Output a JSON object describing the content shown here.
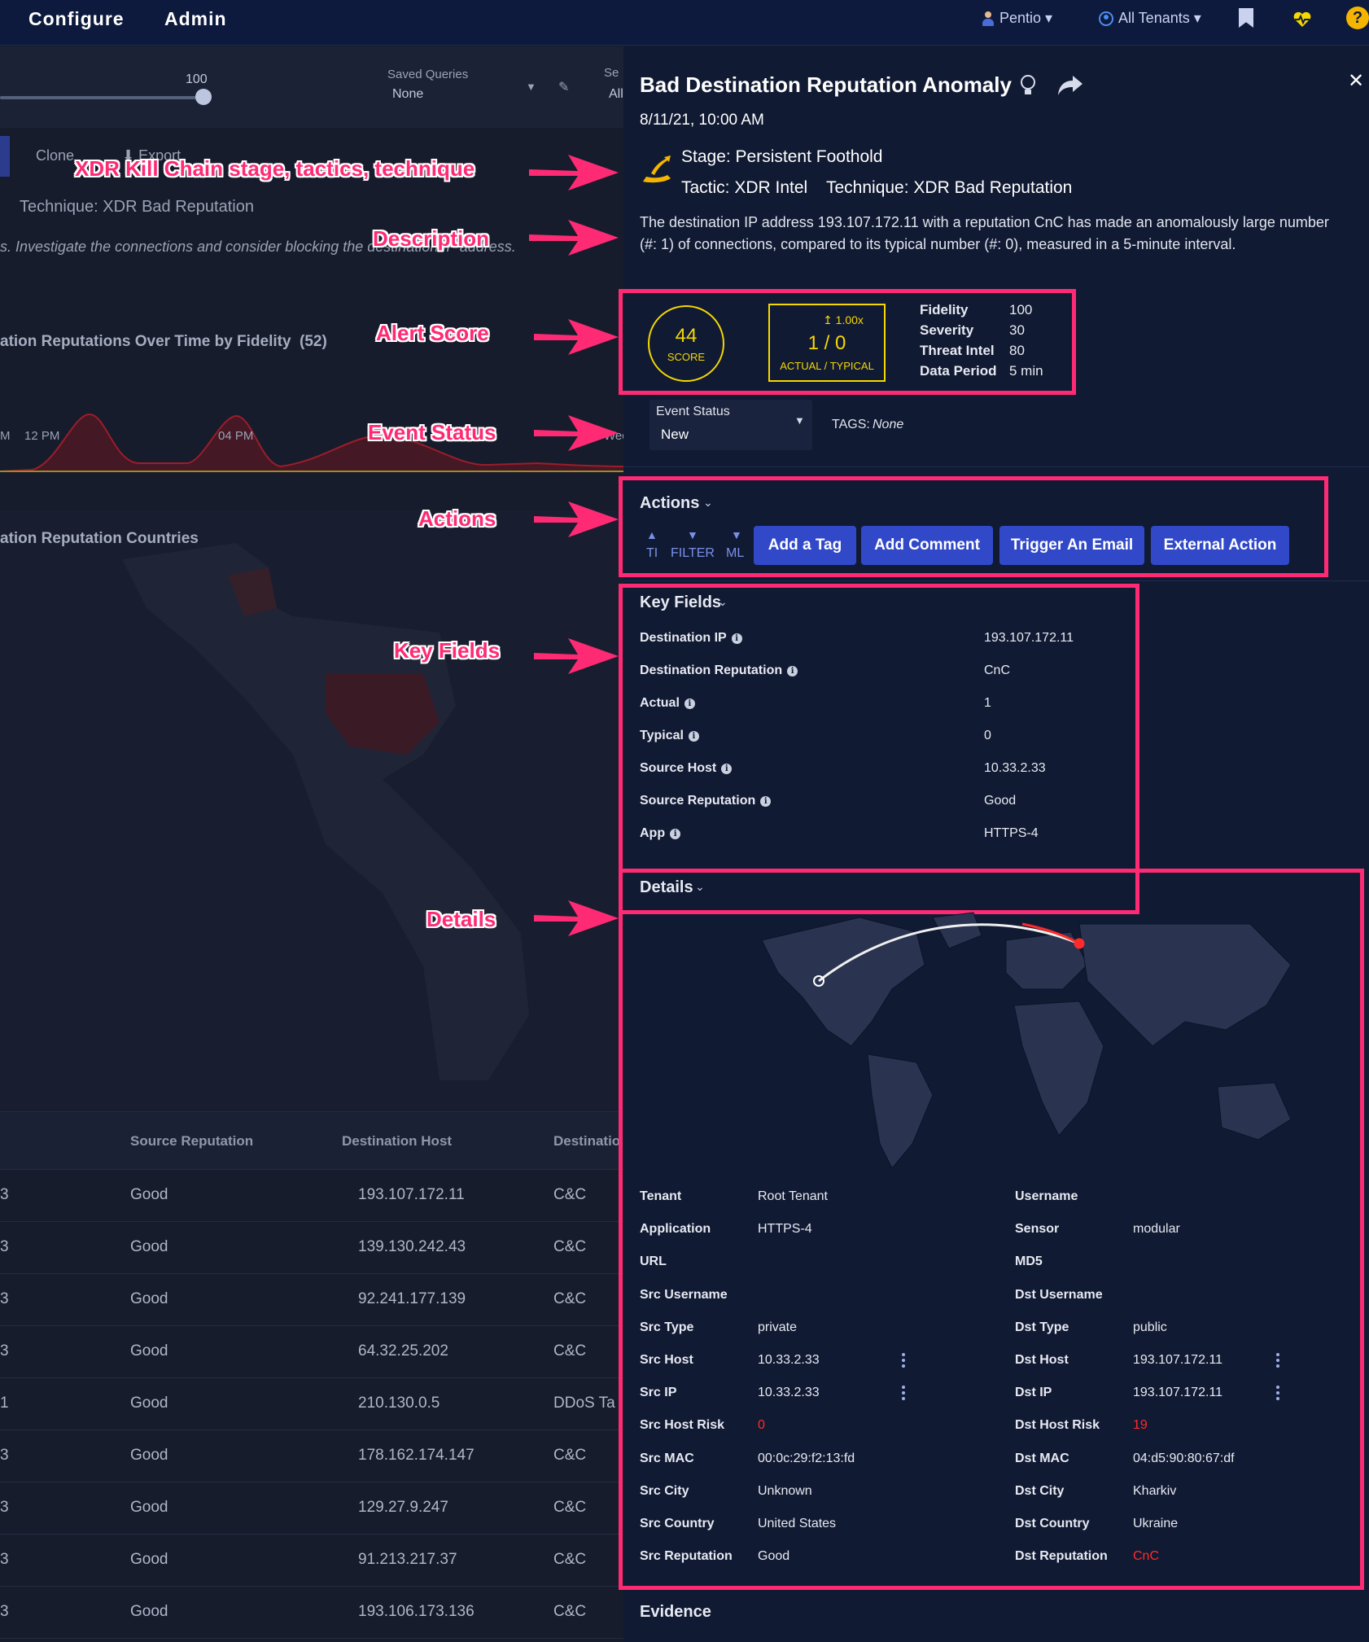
{
  "nav": {
    "configure": "Configure",
    "admin": "Admin",
    "user": "Pentio ▾",
    "tenants": "All Tenants ▾",
    "help": "?"
  },
  "left": {
    "slider_value": "100",
    "saved_queries_label": "Saved Queries",
    "saved_queries_value": "None",
    "sel_label": "Se",
    "sel_value": "All",
    "clone": "Clone",
    "export": "⬇ Export",
    "technique": "Technique: XDR Bad Reputation",
    "description": "s. Investigate the connections and consider blocking the destination IP address.",
    "chart_title": "ation Reputations Over Time by Fidelity",
    "chart_count": "(52)",
    "tick_am": "M",
    "tick_12pm": "12 PM",
    "tick_04pm": "04 PM",
    "tick_wed": "Wed",
    "countries_title": "ation Reputation Countries",
    "table": {
      "headers": [
        "Source Reputation",
        "Destination Host",
        "Destinatio"
      ],
      "rows": [
        [
          "3",
          "Good",
          "193.107.172.11",
          "C&C"
        ],
        [
          "3",
          "Good",
          "139.130.242.43",
          "C&C"
        ],
        [
          "3",
          "Good",
          "92.241.177.139",
          "C&C"
        ],
        [
          "3",
          "Good",
          "64.32.25.202",
          "C&C"
        ],
        [
          "1",
          "Good",
          "210.130.0.5",
          "DDoS Ta"
        ],
        [
          "3",
          "Good",
          "178.162.174.147",
          "C&C"
        ],
        [
          "3",
          "Good",
          "129.27.9.247",
          "C&C"
        ],
        [
          "3",
          "Good",
          "91.213.217.37",
          "C&C"
        ],
        [
          "3",
          "Good",
          "193.106.173.136",
          "C&C"
        ]
      ]
    }
  },
  "annotations": {
    "kill_chain": "XDR Kill Chain stage, tactics, technique",
    "description": "Description",
    "alert_score": "Alert Score",
    "event_status": "Event Status",
    "actions": "Actions",
    "key_fields": "Key Fields",
    "details": "Details"
  },
  "alert": {
    "title": "Bad Destination Reputation Anomaly",
    "datetime": "8/11/21, 10:00 AM",
    "stage": "Stage: Persistent Foothold",
    "tactic": "Tactic: XDR Intel",
    "technique": "Technique: XDR Bad Reputation",
    "description_line1": "The destination IP address 193.107.172.11 with a reputation CnC has made an anomalously large number",
    "description_line2": "(#: 1) of connections, compared to its typical number (#: 0), measured in a 5-minute interval.",
    "score": "44",
    "score_label": "SCORE",
    "ratio_multiplier": "↥ 1.00x",
    "ratio": "1 / 0",
    "ratio_label": "ACTUAL / TYPICAL",
    "metrics": [
      {
        "label": "Fidelity",
        "value": "100"
      },
      {
        "label": "Severity",
        "value": "30"
      },
      {
        "label": "Threat Intel",
        "value": "80"
      },
      {
        "label": "Data Period",
        "value": "5 min"
      }
    ],
    "event_status_label": "Event Status",
    "event_status_value": "New",
    "tags_label": "TAGS:",
    "tags_value": "None"
  },
  "actions": {
    "header": "Actions",
    "ti": "TI",
    "filter": "FILTER",
    "ml": "ML",
    "buttons": [
      "Add a Tag",
      "Add Comment",
      "Trigger An Email",
      "External Action"
    ]
  },
  "key_fields": {
    "header": "Key Fields",
    "rows": [
      {
        "label": "Destination IP",
        "value": "193.107.172.11"
      },
      {
        "label": "Destination Reputation",
        "value": "CnC"
      },
      {
        "label": "Actual",
        "value": "1"
      },
      {
        "label": "Typical",
        "value": "0"
      },
      {
        "label": "Source Host",
        "value": "10.33.2.33"
      },
      {
        "label": "Source Reputation",
        "value": "Good"
      },
      {
        "label": "App",
        "value": "HTTPS-4"
      }
    ]
  },
  "details": {
    "header": "Details",
    "left": [
      {
        "label": "Tenant",
        "value": "Root Tenant"
      },
      {
        "label": "Application",
        "value": "HTTPS-4"
      },
      {
        "label": "URL",
        "value": ""
      },
      {
        "label": "Src Username",
        "value": ""
      },
      {
        "label": "Src Type",
        "value": "private"
      },
      {
        "label": "Src Host",
        "value": "10.33.2.33"
      },
      {
        "label": "Src IP",
        "value": "10.33.2.33"
      },
      {
        "label": "Src Host Risk",
        "value": "0"
      },
      {
        "label": "Src MAC",
        "value": "00:0c:29:f2:13:fd"
      },
      {
        "label": "Src City",
        "value": "Unknown"
      },
      {
        "label": "Src Country",
        "value": "United States"
      },
      {
        "label": "Src Reputation",
        "value": "Good"
      }
    ],
    "right": [
      {
        "label": "Username",
        "value": ""
      },
      {
        "label": "Sensor",
        "value": "modular"
      },
      {
        "label": "MD5",
        "value": ""
      },
      {
        "label": "Dst Username",
        "value": ""
      },
      {
        "label": "Dst Type",
        "value": "public"
      },
      {
        "label": "Dst Host",
        "value": "193.107.172.11"
      },
      {
        "label": "Dst IP",
        "value": "193.107.172.11"
      },
      {
        "label": "Dst Host Risk",
        "value": "19"
      },
      {
        "label": "Dst MAC",
        "value": "04:d5:90:80:67:df"
      },
      {
        "label": "Dst City",
        "value": "Kharkiv"
      },
      {
        "label": "Dst Country",
        "value": "Ukraine"
      },
      {
        "label": "Dst Reputation",
        "value": "CnC"
      }
    ],
    "risk_color": "#ff2a2a"
  },
  "evidence": {
    "header": "Evidence"
  }
}
